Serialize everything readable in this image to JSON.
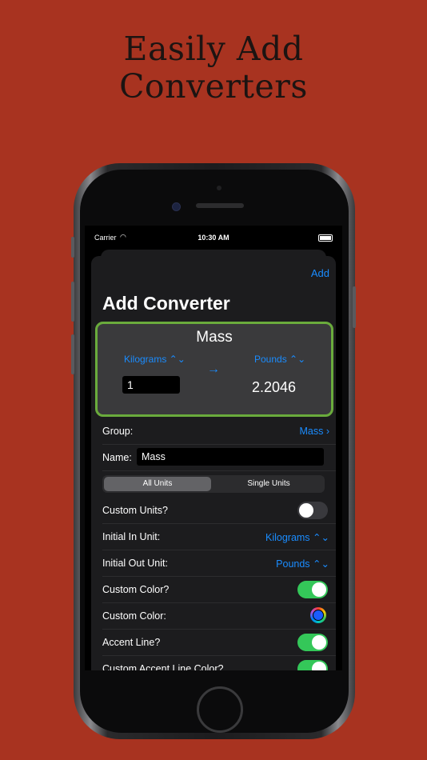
{
  "headline": {
    "line1": "Easily Add",
    "line2": "Converters"
  },
  "status_bar": {
    "carrier": "Carrier",
    "time": "10:30 AM"
  },
  "sheet": {
    "add_label": "Add",
    "title": "Add Converter"
  },
  "preview": {
    "name": "Mass",
    "in_unit": "Kilograms ⌃⌄",
    "out_unit": "Pounds ⌃⌄",
    "in_value": "1",
    "out_value": "2.2046"
  },
  "form": {
    "group_label": "Group:",
    "group_value": "Mass",
    "name_label": "Name:",
    "name_value": "Mass",
    "segment": {
      "all": "All Units",
      "single": "Single Units",
      "selected": "All Units"
    },
    "custom_units_label": "Custom Units?",
    "custom_units_on": false,
    "initial_in_label": "Initial In Unit:",
    "initial_in_value": "Kilograms",
    "initial_out_label": "Initial Out Unit:",
    "initial_out_value": "Pounds",
    "custom_color_toggle_label": "Custom Color?",
    "custom_color_on": true,
    "custom_color_label": "Custom Color:",
    "custom_color_value": "#1a5cff",
    "accent_line_label": "Accent Line?",
    "accent_line_on": true,
    "custom_accent_label": "Custom Accent Line Color?",
    "custom_accent_on": true
  },
  "colors": {
    "background": "#a83320",
    "accent": "#1a8cff",
    "card_border": "#6aab3c",
    "toggle_on": "#34c759"
  }
}
